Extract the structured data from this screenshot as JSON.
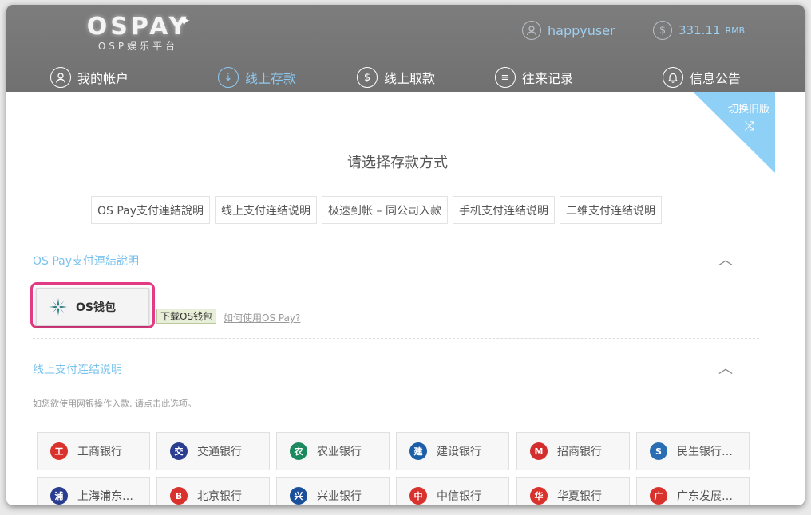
{
  "header": {
    "logo_main": "OSPAY",
    "logo_sub": "OSP娱乐平台",
    "username": "happyuser",
    "balance": "331.11",
    "currency": "RMB"
  },
  "nav": [
    {
      "label": "我的帐户",
      "icon": "person-icon",
      "active": false
    },
    {
      "label": "线上存款",
      "icon": "deposit-icon",
      "active": true
    },
    {
      "label": "线上取款",
      "icon": "withdraw-icon",
      "active": false
    },
    {
      "label": "往来记录",
      "icon": "records-icon",
      "active": false
    },
    {
      "label": "信息公告",
      "icon": "bell-icon",
      "active": false
    }
  ],
  "corner": {
    "label": "切换旧版",
    "icon": "shuffle-icon"
  },
  "main": {
    "title": "请选择存款方式",
    "tabs": [
      "OS Pay支付連結說明",
      "线上支付连结说明",
      "极速到帐 – 同公司入款",
      "手机支付连结说明",
      "二维支付连结说明"
    ]
  },
  "ospay_section": {
    "title": "OS Pay支付連結說明",
    "wallet_label": "OS钱包",
    "download_label": "下载OS钱包",
    "howto_label": "如何使用OS Pay?"
  },
  "online_section": {
    "title": "线上支付连结说明",
    "hint": "如您欲使用网银操作入款, 请点击此选项。",
    "banks": [
      {
        "name": "工商银行",
        "color": "#d9312b",
        "glyph": "工"
      },
      {
        "name": "交通银行",
        "color": "#2a3d8f",
        "glyph": "交"
      },
      {
        "name": "农业银行",
        "color": "#1c8a5e",
        "glyph": "农"
      },
      {
        "name": "建设银行",
        "color": "#1a5fa8",
        "glyph": "建"
      },
      {
        "name": "招商银行",
        "color": "#d32d2d",
        "glyph": "M"
      },
      {
        "name": "民生银行…",
        "color": "#2a6db2",
        "glyph": "S"
      },
      {
        "name": "上海浦东…",
        "color": "#2a3d8f",
        "glyph": "浦"
      },
      {
        "name": "北京银行",
        "color": "#d9312b",
        "glyph": "B"
      },
      {
        "name": "兴业银行",
        "color": "#1a4f9c",
        "glyph": "兴"
      },
      {
        "name": "中信银行",
        "color": "#d9312b",
        "glyph": "中"
      },
      {
        "name": "华夏银行",
        "color": "#d9312b",
        "glyph": "华"
      },
      {
        "name": "广东发展…",
        "color": "#d9312b",
        "glyph": "广"
      }
    ]
  },
  "colors": {
    "accent": "#79c2ee",
    "highlight": "#e23b83",
    "topbar": "#777777"
  }
}
